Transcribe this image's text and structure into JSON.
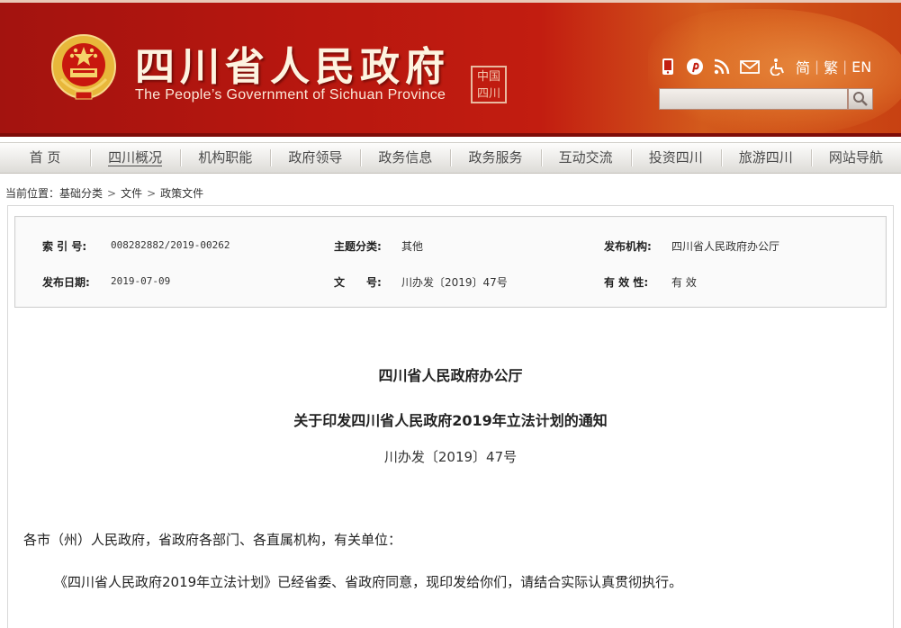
{
  "header": {
    "title_cn": "四川省人民政府",
    "title_en": "The People’s Government of Sichuan Province",
    "seal_text": "中国四川",
    "tools": [
      "mobile-icon",
      "pinterest-icon",
      "rss-icon",
      "mail-icon",
      "accessibility-icon"
    ],
    "lang_simplified": "简",
    "lang_traditional": "繁",
    "lang_english": "EN",
    "search_placeholder": "",
    "colors": {
      "banner": "#b8170f",
      "text": "#fdf3e0"
    }
  },
  "nav": {
    "items": [
      {
        "label": "首 页"
      },
      {
        "label": "四川概况"
      },
      {
        "label": "机构职能"
      },
      {
        "label": "政府领导"
      },
      {
        "label": "政务信息"
      },
      {
        "label": "政务服务"
      },
      {
        "label": "互动交流"
      },
      {
        "label": "投资四川"
      },
      {
        "label": "旅游四川"
      },
      {
        "label": "网站导航"
      }
    ],
    "active_index": 1
  },
  "breadcrumb": {
    "prefix": "当前位置：",
    "items": [
      "基础分类",
      "文件",
      "政策文件"
    ],
    "separator": ">"
  },
  "meta": {
    "index_label": "索 引 号:",
    "index_value": "008282882/2019-00262",
    "category_label": "主题分类:",
    "category_value": "其他",
    "issuer_label": "发布机构:",
    "issuer_value": "四川省人民政府办公厅",
    "date_label": "发布日期:",
    "date_value": "2019-07-09",
    "docno_label": "文　　号:",
    "docno_value": "川办发〔2019〕47号",
    "validity_label": "有 效 性:",
    "validity_value": "有 效"
  },
  "document": {
    "org": "四川省人民政府办公厅",
    "title": "关于印发四川省人民政府2019年立法计划的通知",
    "number": "川办发〔2019〕47号",
    "salutation": "各市（州）人民政府，省政府各部门、各直属机构，有关单位：",
    "paragraph1": "《四川省人民政府2019年立法计划》已经省委、省政府同意，现印发给你们，请结合实际认真贯彻执行。"
  }
}
